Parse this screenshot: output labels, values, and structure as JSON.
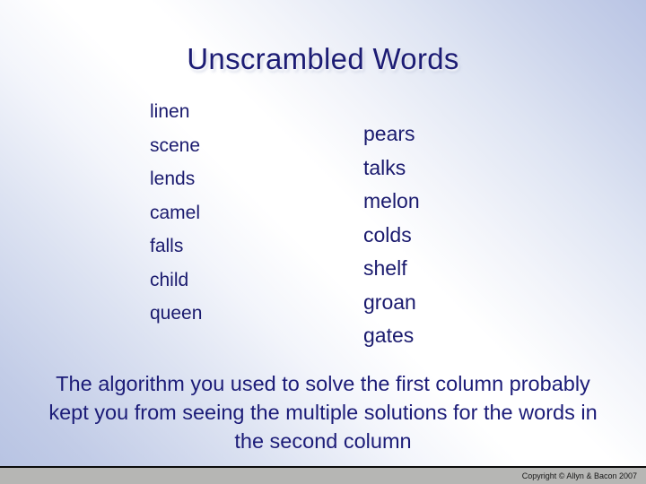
{
  "slide": {
    "title": "Unscrambled Words",
    "columns": [
      {
        "name": "first-column",
        "words": [
          "linen",
          "scene",
          "lends",
          "camel",
          "falls",
          "child",
          "queen"
        ]
      },
      {
        "name": "second-column",
        "words": [
          "pears",
          "talks",
          "melon",
          "colds",
          "shelf",
          "groan",
          "gates"
        ]
      }
    ],
    "paragraph": "The algorithm you used to solve the first column probably kept you from seeing the multiple solutions for the words in the second column",
    "footer": {
      "copyright": "Copyright © Allyn & Bacon 2007"
    }
  },
  "colors": {
    "title_text": "#1c1c74",
    "word_text": "#1a1a6e",
    "paragraph_text": "#1c1c78",
    "background_blue": "#b9c4e4",
    "background_white": "#ffffff",
    "footer_bar": "#b6b6b4",
    "footer_text": "#161616"
  }
}
